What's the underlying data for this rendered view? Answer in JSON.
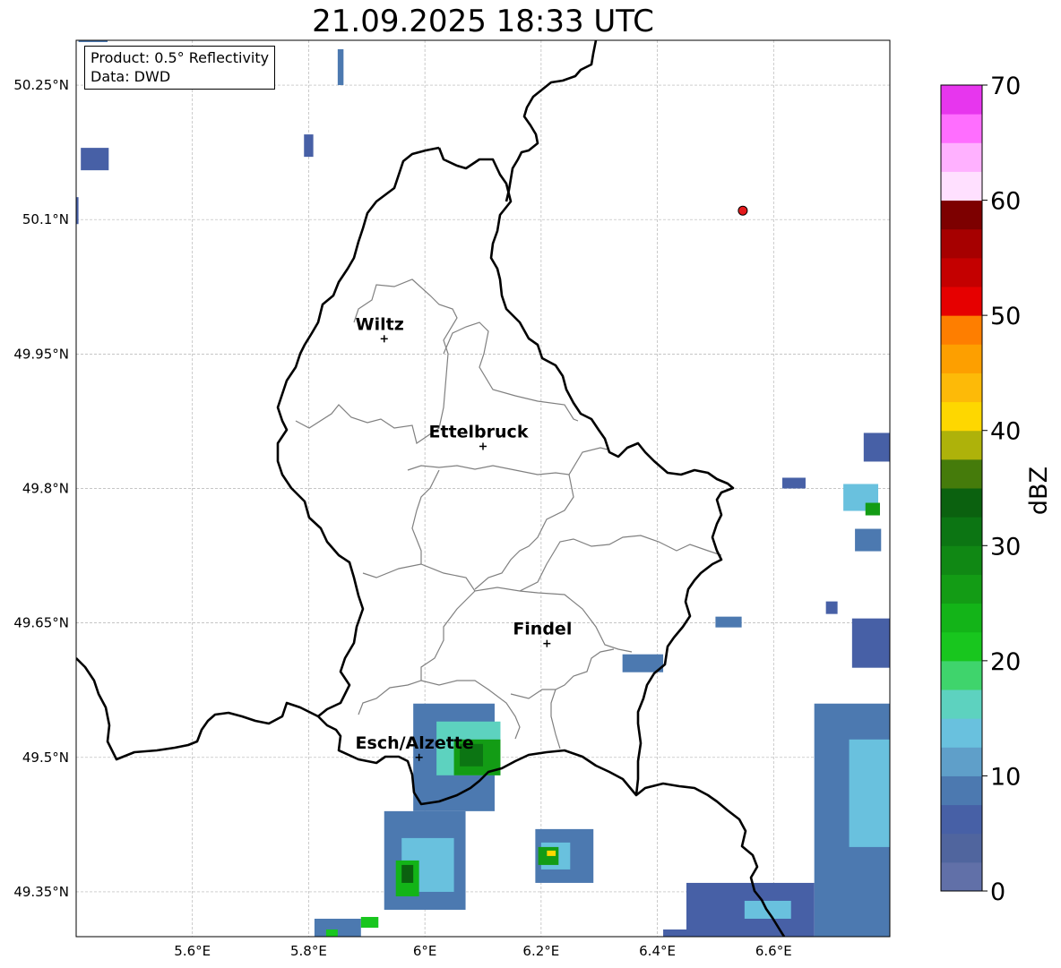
{
  "title": "21.09.2025 18:33 UTC",
  "info": {
    "product": "Product: 0.5° Reflectivity",
    "source": "Data: DWD"
  },
  "map": {
    "lon_range": [
      5.4,
      6.8
    ],
    "lat_range": [
      49.3,
      50.3
    ],
    "lon_ticks": [
      {
        "value": 5.6,
        "label": "5.6°E"
      },
      {
        "value": 5.8,
        "label": "5.8°E"
      },
      {
        "value": 6.0,
        "label": "6°E"
      },
      {
        "value": 6.2,
        "label": "6.2°E"
      },
      {
        "value": 6.4,
        "label": "6.4°E"
      },
      {
        "value": 6.6,
        "label": "6.6°E"
      }
    ],
    "lat_ticks": [
      {
        "value": 50.25,
        "label": "50.25°N"
      },
      {
        "value": 50.1,
        "label": "50.1°N"
      },
      {
        "value": 49.95,
        "label": "49.95°N"
      },
      {
        "value": 49.8,
        "label": "49.8°N"
      },
      {
        "value": 49.65,
        "label": "49.65°N"
      },
      {
        "value": 49.5,
        "label": "49.5°N"
      },
      {
        "value": 49.35,
        "label": "49.35°N"
      }
    ],
    "grid": true,
    "cities": [
      {
        "name": "Wiltz",
        "lon": 5.93,
        "lat": 49.967
      },
      {
        "name": "Ettelbruck",
        "lon": 6.1,
        "lat": 49.847
      },
      {
        "name": "Findel",
        "lon": 6.21,
        "lat": 49.627
      },
      {
        "name": "Esch/Alzette",
        "lon": 5.99,
        "lat": 49.5
      }
    ],
    "radar_site": {
      "lon": 6.547,
      "lat": 50.11,
      "color": "#e41a1c"
    },
    "echoes": [
      {
        "lon": 5.404,
        "lat": 50.298,
        "dlon": 0.05,
        "dlat": 0.008,
        "dbz": 8
      },
      {
        "lon": 5.408,
        "lat": 50.155,
        "dlon": 0.048,
        "dlat": 0.025,
        "dbz": 7
      },
      {
        "lon": 5.4,
        "lat": 50.095,
        "dlon": 0.004,
        "dlat": 0.03,
        "dbz": 5
      },
      {
        "lon": 5.85,
        "lat": 50.25,
        "dlon": 0.01,
        "dlat": 0.04,
        "dbz": 8
      },
      {
        "lon": 5.792,
        "lat": 50.17,
        "dlon": 0.016,
        "dlat": 0.025,
        "dbz": 6
      },
      {
        "lon": 6.755,
        "lat": 49.83,
        "dlon": 0.045,
        "dlat": 0.032,
        "dbz": 7
      },
      {
        "lon": 6.72,
        "lat": 49.775,
        "dlon": 0.06,
        "dlat": 0.03,
        "dbz": 14
      },
      {
        "lon": 6.758,
        "lat": 49.77,
        "dlon": 0.025,
        "dlat": 0.014,
        "dbz": 25
      },
      {
        "lon": 6.74,
        "lat": 49.73,
        "dlon": 0.045,
        "dlat": 0.025,
        "dbz": 8
      },
      {
        "lon": 6.69,
        "lat": 49.66,
        "dlon": 0.02,
        "dlat": 0.014,
        "dbz": 6
      },
      {
        "lon": 6.615,
        "lat": 49.8,
        "dlon": 0.04,
        "dlat": 0.012,
        "dbz": 6
      },
      {
        "lon": 6.5,
        "lat": 49.645,
        "dlon": 0.045,
        "dlat": 0.012,
        "dbz": 9
      },
      {
        "lon": 6.34,
        "lat": 49.595,
        "dlon": 0.07,
        "dlat": 0.02,
        "dbz": 9
      },
      {
        "lon": 6.735,
        "lat": 49.6,
        "dlon": 0.065,
        "dlat": 0.055,
        "dbz": 7
      },
      {
        "lon": 6.67,
        "lat": 49.3,
        "dlon": 0.13,
        "dlat": 0.26,
        "dbz": 9
      },
      {
        "lon": 6.73,
        "lat": 49.4,
        "dlon": 0.07,
        "dlat": 0.12,
        "dbz": 14
      },
      {
        "lon": 6.45,
        "lat": 49.3,
        "dlon": 0.22,
        "dlat": 0.06,
        "dbz": 7
      },
      {
        "lon": 6.55,
        "lat": 49.32,
        "dlon": 0.08,
        "dlat": 0.02,
        "dbz": 13
      },
      {
        "lon": 6.19,
        "lat": 49.36,
        "dlon": 0.1,
        "dlat": 0.06,
        "dbz": 9
      },
      {
        "lon": 6.2,
        "lat": 49.375,
        "dlon": 0.05,
        "dlat": 0.03,
        "dbz": 14
      },
      {
        "lon": 6.195,
        "lat": 49.38,
        "dlon": 0.035,
        "dlat": 0.02,
        "dbz": 25
      },
      {
        "lon": 6.21,
        "lat": 49.39,
        "dlon": 0.015,
        "dlat": 0.006,
        "dbz": 40
      },
      {
        "lon": 5.98,
        "lat": 49.44,
        "dlon": 0.14,
        "dlat": 0.12,
        "dbz": 9
      },
      {
        "lon": 6.02,
        "lat": 49.48,
        "dlon": 0.11,
        "dlat": 0.06,
        "dbz": 15
      },
      {
        "lon": 6.05,
        "lat": 49.48,
        "dlon": 0.08,
        "dlat": 0.04,
        "dbz": 25
      },
      {
        "lon": 6.06,
        "lat": 49.49,
        "dlon": 0.04,
        "dlat": 0.025,
        "dbz": 31
      },
      {
        "lon": 5.93,
        "lat": 49.33,
        "dlon": 0.14,
        "dlat": 0.11,
        "dbz": 8
      },
      {
        "lon": 5.96,
        "lat": 49.35,
        "dlon": 0.09,
        "dlat": 0.06,
        "dbz": 14
      },
      {
        "lon": 5.95,
        "lat": 49.345,
        "dlon": 0.04,
        "dlat": 0.04,
        "dbz": 23
      },
      {
        "lon": 5.96,
        "lat": 49.36,
        "dlon": 0.02,
        "dlat": 0.02,
        "dbz": 34
      },
      {
        "lon": 5.81,
        "lat": 49.3,
        "dlon": 0.08,
        "dlat": 0.02,
        "dbz": 8
      },
      {
        "lon": 5.83,
        "lat": 49.3,
        "dlon": 0.02,
        "dlat": 0.008,
        "dbz": 22
      },
      {
        "lon": 5.89,
        "lat": 49.31,
        "dlon": 0.03,
        "dlat": 0.012,
        "dbz": 22
      },
      {
        "lon": 6.41,
        "lat": 49.3,
        "dlon": 0.05,
        "dlat": 0.008,
        "dbz": 6
      }
    ]
  },
  "colorbar": {
    "label": "dBZ",
    "min": 0,
    "max": 70,
    "step": 2.5,
    "colors": [
      "#6170a8",
      "#50659e",
      "#4760a6",
      "#4c79b0",
      "#5f9fc9",
      "#69c1de",
      "#5dd2bf",
      "#3fd46c",
      "#18c61e",
      "#13b418",
      "#139c15",
      "#108814",
      "#0c7513",
      "#0b610f",
      "#457b0b",
      "#aeb20a",
      "#fed700",
      "#fdba08",
      "#fd9f00",
      "#fe7e00",
      "#e60000",
      "#c40000",
      "#a60000",
      "#7d0000",
      "#ffe0ff",
      "#ffb1ff",
      "#ff6eff",
      "#e736ee"
    ],
    "ticks": [
      {
        "value": 0,
        "label": "0"
      },
      {
        "value": 10,
        "label": "10"
      },
      {
        "value": 20,
        "label": "20"
      },
      {
        "value": 30,
        "label": "30"
      },
      {
        "value": 40,
        "label": "40"
      },
      {
        "value": 50,
        "label": "50"
      },
      {
        "value": 60,
        "label": "60"
      },
      {
        "value": 70,
        "label": "70"
      }
    ]
  }
}
